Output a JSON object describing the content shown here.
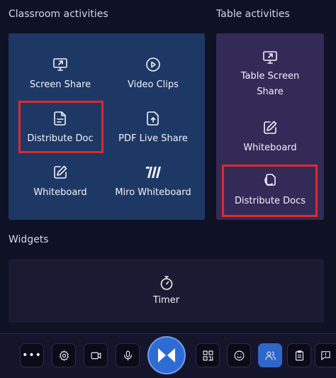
{
  "sections": {
    "classroom": "Classroom activities",
    "table": "Table activities",
    "widgets": "Widgets"
  },
  "classroom_tiles": {
    "screen_share": {
      "label": "Screen Share",
      "icon": "screen-share-icon"
    },
    "video_clips": {
      "label": "Video Clips",
      "icon": "play-circle-icon"
    },
    "distribute_doc": {
      "label": "Distribute Doc",
      "icon": "document-icon"
    },
    "pdf_live_share": {
      "label": "PDF Live Share",
      "icon": "upload-document-icon"
    },
    "whiteboard": {
      "label": "Whiteboard",
      "icon": "pen-square-icon"
    },
    "miro_whiteboard": {
      "label": "Miro Whiteboard",
      "icon": "miro-logo-icon"
    }
  },
  "table_tiles": {
    "table_screen_share": {
      "label_line1": "Table Screen",
      "label_line2": "Share",
      "icon": "screen-share-icon"
    },
    "whiteboard": {
      "label": "Whiteboard",
      "icon": "pen-square-icon"
    },
    "distribute_docs": {
      "label": "Distribute Docs",
      "icon": "documents-stack-icon"
    }
  },
  "widgets": {
    "timer": {
      "label": "Timer",
      "icon": "stopwatch-icon"
    }
  },
  "toolbar": {
    "more": "•••",
    "items": [
      "more-icon",
      "gear-icon",
      "video-camera-icon",
      "microphone-icon",
      "logo-icon",
      "qr-code-icon",
      "smiley-icon",
      "people-icon",
      "clipboard-icon",
      "help-chat-icon"
    ],
    "active_item": "people-icon"
  },
  "colors": {
    "background": "#0f1124",
    "classroom_panel": "#1d3865",
    "table_panel": "#332a58",
    "widgets_panel": "#1a1b33",
    "highlight": "#e0282c",
    "accent": "#2f6bd4"
  }
}
